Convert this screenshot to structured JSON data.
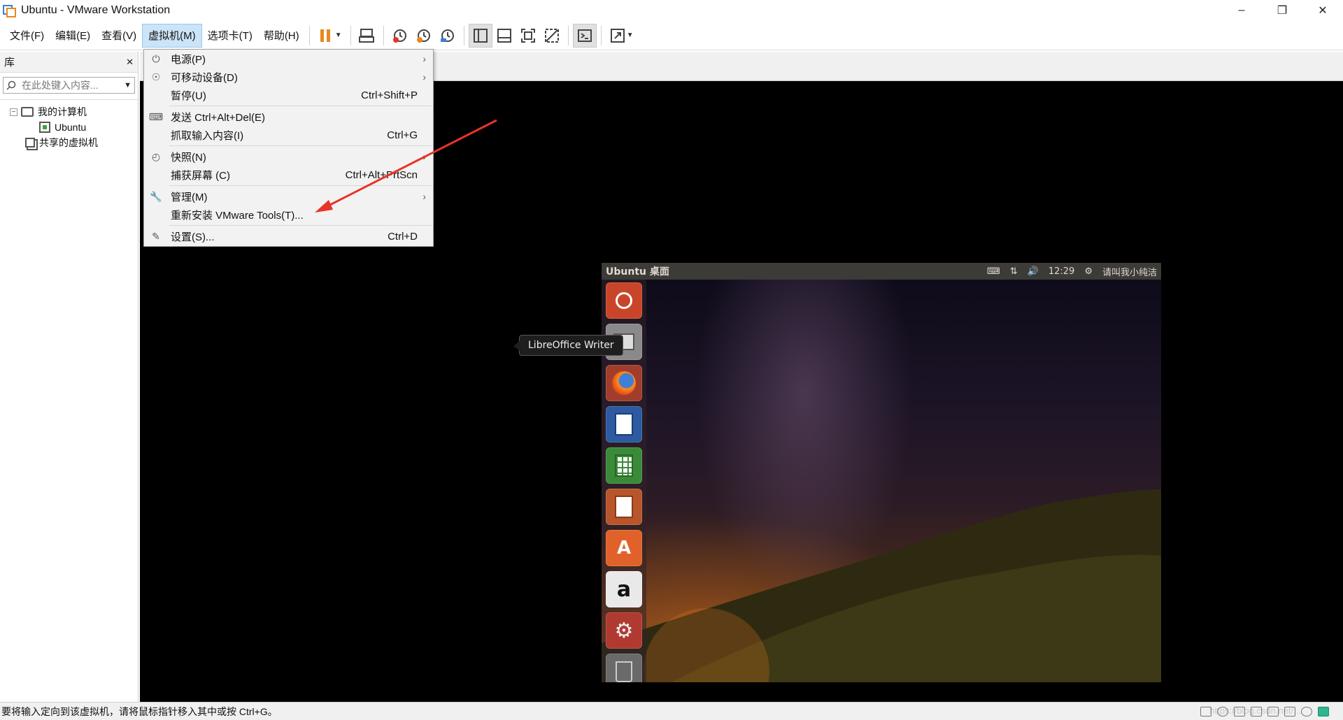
{
  "window": {
    "title": "Ubuntu - VMware Workstation"
  },
  "menubar": {
    "items": [
      {
        "label": "文件(F)"
      },
      {
        "label": "编辑(E)"
      },
      {
        "label": "查看(V)"
      },
      {
        "label": "虚拟机(M)"
      },
      {
        "label": "选项卡(T)"
      },
      {
        "label": "帮助(H)"
      }
    ]
  },
  "library": {
    "header": "库",
    "close": "✕",
    "search_placeholder": "在此处键入内容...",
    "tree": {
      "my_computer": "我的计算机",
      "ubuntu": "Ubuntu",
      "shared": "共享的虚拟机"
    }
  },
  "vm_menu": {
    "items": [
      {
        "label": "电源(P)",
        "shortcut": "",
        "submenu": true
      },
      {
        "label": "可移动设备(D)",
        "shortcut": "",
        "submenu": true
      },
      {
        "label": "暂停(U)",
        "shortcut": "Ctrl+Shift+P",
        "submenu": false
      },
      {
        "label": "发送 Ctrl+Alt+Del(E)",
        "shortcut": "",
        "submenu": false
      },
      {
        "label": "抓取输入内容(I)",
        "shortcut": "Ctrl+G",
        "submenu": false
      },
      {
        "label": "快照(N)",
        "shortcut": "",
        "submenu": true
      },
      {
        "label": "捕获屏幕 (C)",
        "shortcut": "Ctrl+Alt+PrtScn",
        "submenu": false
      },
      {
        "label": "管理(M)",
        "shortcut": "",
        "submenu": true
      },
      {
        "label": "重新安装 VMware Tools(T)...",
        "shortcut": "",
        "submenu": false
      },
      {
        "label": "设置(S)...",
        "shortcut": "Ctrl+D",
        "submenu": false
      }
    ],
    "submenu_glyph": "›"
  },
  "guest": {
    "panel_title": "Ubuntu 桌面",
    "time": "12:29",
    "user": "请叫我小纯洁",
    "tooltip": "LibreOffice Writer",
    "launcher": [
      {
        "icon": "ubuntu-dash-icon"
      },
      {
        "icon": "files-icon"
      },
      {
        "icon": "firefox-icon"
      },
      {
        "icon": "libreoffice-writer-icon"
      },
      {
        "icon": "libreoffice-calc-icon"
      },
      {
        "icon": "libreoffice-impress-icon"
      },
      {
        "icon": "software-center-icon",
        "glyph": "A"
      },
      {
        "icon": "amazon-icon",
        "glyph": "a"
      },
      {
        "icon": "system-settings-icon"
      },
      {
        "icon": "trash-icon"
      }
    ]
  },
  "statusbar": {
    "message": "要将输入定向到该虚拟机，请将鼠标指针移入其中或按 Ctrl+G。",
    "watermark": "https://blog.csdn.net/..."
  },
  "colors": {
    "menu_highlight": "#cce4f7",
    "annotation_arrow": "#e8322a",
    "pause_orange": "#e8891d"
  }
}
